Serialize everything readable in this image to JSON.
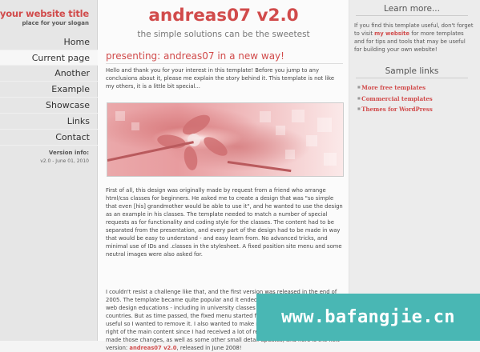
{
  "site": {
    "title": "your website title",
    "slogan": "place for your slogan"
  },
  "menu": {
    "items": [
      {
        "label": "Home"
      },
      {
        "label": "Current page"
      },
      {
        "label": "Another"
      },
      {
        "label": "Example"
      },
      {
        "label": "Showcase"
      },
      {
        "label": "Links"
      },
      {
        "label": "Contact"
      }
    ],
    "current_index": 1
  },
  "version": {
    "heading": "Version info:",
    "text": "v2.0 - June 01, 2010"
  },
  "main": {
    "title": "andreas07 v2.0",
    "subtitle": "the simple solutions can be the sweetest",
    "article_heading": "presenting: andreas07 in a new way!",
    "p1": "Hello and thank you for your interest in this template! Before you jump to any conclusions about it, please me explain the story behind it. This template is not like my others, it is a little bit special...",
    "p2": "First of all, this design was originally made by request from a friend who arrange html/css classes for beginners. He asked me to create a design that was \"so simple that even [his] grandmother would be able to use it\", and he wanted to use the design as an example in his classes. The template needed to match a number of special requests as for functionality and coding style for the classes. The content had to be separated from the presentation, and every part of the design had to be made in way that would be easy to understand - and easy learn from. No advanced tricks, and minimal use of IDs and .classes in the stylesheet. A fixed position site menu and some neutral images were also asked for.",
    "p3_before": "I couldn't resist a challenge like that, and the first version was released in the end of 2005. The template became quite popular and it ended up being used in many other web design educations - including in university classes and high schools in several countries. But as time passed, the fixed menu started feeling more annoying than useful so I wanted to remove it. I also wanted to make room for a third column to the right of the main content since I had received a lot of requests about that. Now I have made those changes, as well as some other small detail updates, and here is the new version: ",
    "p3_link": "andreas07 v2.0",
    "p3_after": ", released in June 2008!"
  },
  "right": {
    "learn_heading": "Learn more...",
    "learn_before": "If you find this template useful, don't forget to visit ",
    "learn_link": "my website",
    "learn_after": " for more templates and for tips and tools that may be useful for building your own website!",
    "sample_heading": "Sample links",
    "sample_links": [
      "More free templates",
      "Commercial templates",
      "Themes for WordPress"
    ]
  },
  "watermark": {
    "text": "www.bafangjie.cn"
  },
  "colors": {
    "accent": "#d14b4b",
    "watermark_bg": "#49b7b4"
  }
}
